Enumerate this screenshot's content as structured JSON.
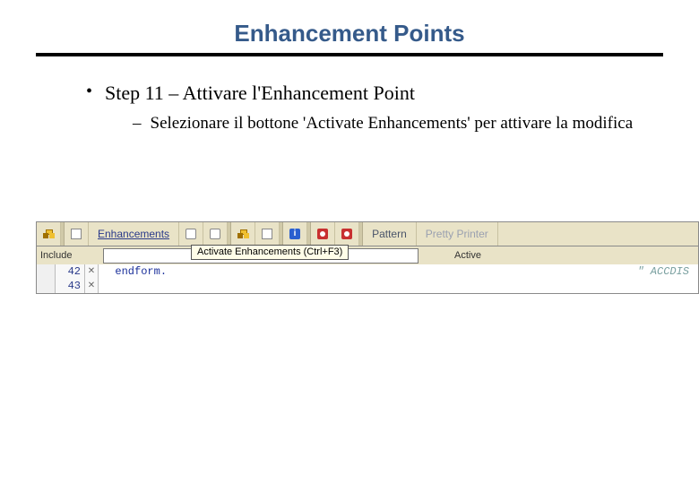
{
  "title": "Enhancement Points",
  "bullet1": "Step 11 – Attivare l'Enhancement Point",
  "bullet2": "Selezionare il bottone  'Activate Enhancements' per attivare la modifica",
  "toolbar": {
    "enhancements_label": "Enhancements",
    "pattern_label": "Pattern",
    "pretty_printer_label": "Pretty Printer"
  },
  "tooltip": "Activate Enhancements   (Ctrl+F3)",
  "include_label": "Include",
  "status_label": "Active",
  "code": {
    "lines": [
      {
        "no": "42",
        "marker": "✕",
        "text": "endform.",
        "comment": "\" ACCDIS"
      },
      {
        "no": "43",
        "marker": "✕",
        "text": "",
        "comment": ""
      }
    ]
  }
}
